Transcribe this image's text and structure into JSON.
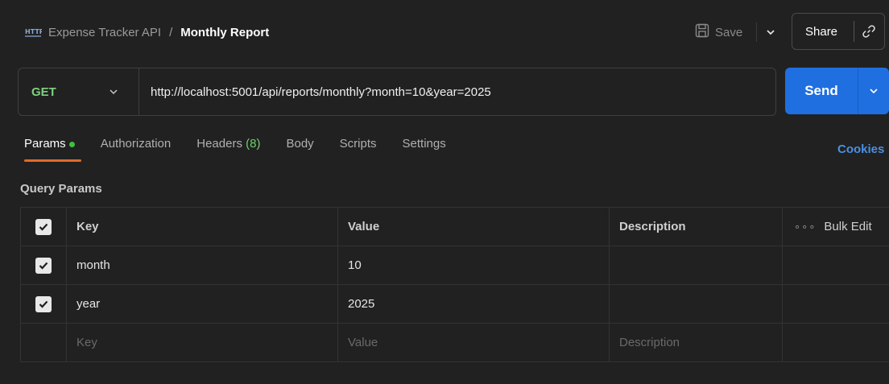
{
  "header": {
    "collection": "Expense Tracker API",
    "separator": "/",
    "request_name": "Monthly Report",
    "save_label": "Save",
    "share_label": "Share"
  },
  "request": {
    "method": "GET",
    "url": "http://localhost:5001/api/reports/monthly?month=10&year=2025",
    "send_label": "Send"
  },
  "tabs": [
    {
      "label": "Params"
    },
    {
      "label": "Authorization"
    },
    {
      "label": "Headers",
      "count": "(8)"
    },
    {
      "label": "Body"
    },
    {
      "label": "Scripts"
    },
    {
      "label": "Settings"
    }
  ],
  "cookies_label": "Cookies",
  "query_params": {
    "title": "Query Params",
    "columns": {
      "key": "Key",
      "value": "Value",
      "description": "Description",
      "bulk_edit": "Bulk Edit"
    },
    "rows": [
      {
        "key": "month",
        "value": "10",
        "description": ""
      },
      {
        "key": "year",
        "value": "2025",
        "description": ""
      }
    ],
    "placeholders": {
      "key": "Key",
      "value": "Value",
      "description": "Description"
    }
  },
  "colors": {
    "accent_blue": "#1f6fe0",
    "method_green": "#7fd17f",
    "tab_underline": "#e06b2c",
    "cookies_link": "#4a90e2"
  }
}
